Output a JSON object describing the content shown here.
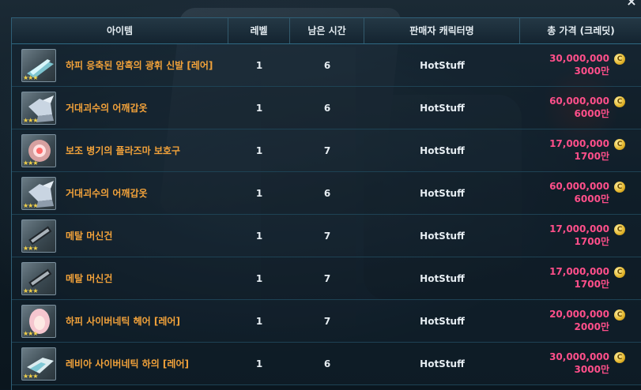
{
  "headers": {
    "item": "아이템",
    "level": "레벨",
    "time_left": "남은 시간",
    "seller": "판매자 캐릭터명",
    "total_price": "총 가격 (크레딧)"
  },
  "coin_glyph": "C",
  "close_glyph": "×",
  "colors": {
    "item_name": "#f2a23a",
    "price": "#ff4f8a",
    "header_bg": "#1c2f3b",
    "border": "#2f6a84"
  },
  "rows": [
    {
      "icon": "shoes-icon",
      "name": "하피 응축된 암흑의 광휘 신발 [레어]",
      "level": "1",
      "time": "6",
      "seller": "HotStuff",
      "price": "30,000,000",
      "price_short": "3000만",
      "stars": "★★★"
    },
    {
      "icon": "shoulder-armor-icon",
      "name": "거대괴수의 어깨갑옷",
      "level": "1",
      "time": "6",
      "seller": "HotStuff",
      "price": "60,000,000",
      "price_short": "6000만",
      "stars": "★★★"
    },
    {
      "icon": "plasma-guard-icon",
      "name": "보조 병기의 플라즈마 보호구",
      "level": "1",
      "time": "7",
      "seller": "HotStuff",
      "price": "17,000,000",
      "price_short": "1700만",
      "stars": "★★★"
    },
    {
      "icon": "shoulder-armor-icon",
      "name": "거대괴수의 어깨갑옷",
      "level": "1",
      "time": "6",
      "seller": "HotStuff",
      "price": "60,000,000",
      "price_short": "6000만",
      "stars": "★★★"
    },
    {
      "icon": "machine-gun-icon",
      "name": "메탈 머신건",
      "level": "1",
      "time": "7",
      "seller": "HotStuff",
      "price": "17,000,000",
      "price_short": "1700만",
      "stars": "★★★"
    },
    {
      "icon": "machine-gun-icon",
      "name": "메탈 머신건",
      "level": "1",
      "time": "7",
      "seller": "HotStuff",
      "price": "17,000,000",
      "price_short": "1700만",
      "stars": "★★★"
    },
    {
      "icon": "cyber-hair-icon",
      "name": "하피 사이버네틱 헤어 [레어]",
      "level": "1",
      "time": "7",
      "seller": "HotStuff",
      "price": "20,000,000",
      "price_short": "2000만",
      "stars": "★★★"
    },
    {
      "icon": "cyber-pants-icon",
      "name": "레비아 사이버네틱 하의 [레어]",
      "level": "1",
      "time": "6",
      "seller": "HotStuff",
      "price": "30,000,000",
      "price_short": "3000만",
      "stars": "★★★"
    }
  ]
}
